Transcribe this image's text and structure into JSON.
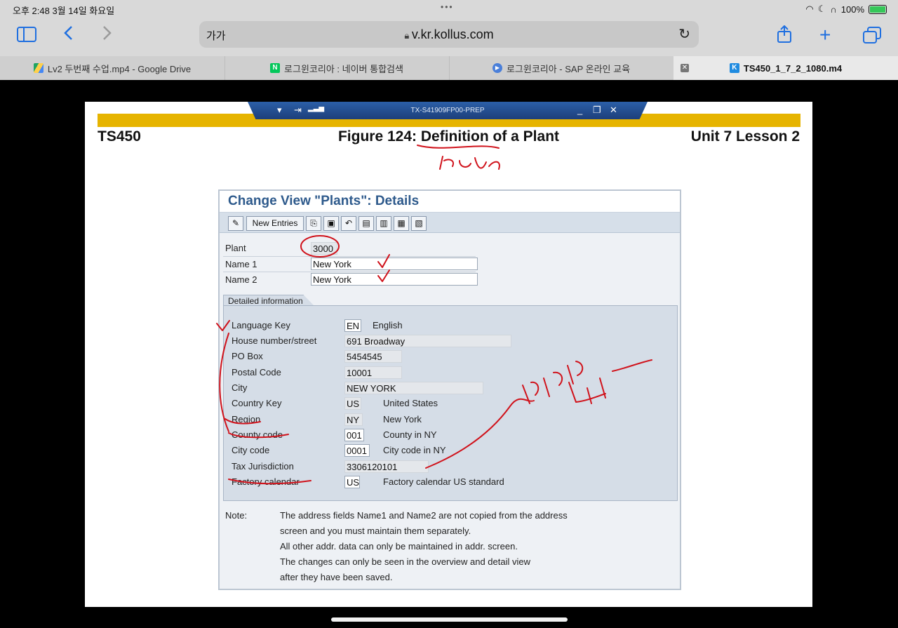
{
  "status_bar": {
    "time": "오후 2:48   3월 14일 화요일",
    "battery": "100%"
  },
  "browser": {
    "text_size_label": "가가",
    "url": "v.kr.kollus.com",
    "tabs": [
      {
        "title": "Lv2 두번째 수업.mp4 - Google Drive",
        "icon": "google-drive-icon"
      },
      {
        "title": "로그윈코리아 : 네이버 통합검색",
        "icon": "naver-icon"
      },
      {
        "title": "로그윈코리아 - SAP 온라인 교육",
        "icon": "play-icon"
      },
      {
        "title": "TS450_1_7_2_1080.m4",
        "icon": "kollus-icon"
      }
    ]
  },
  "slide": {
    "window_title": "TX-S41909FP00-PREP",
    "left_header": "TS450",
    "center_header": "Figure 124: Definition of a Plant",
    "right_header": "Unit 7 Lesson 2",
    "sap_screen": {
      "title": "Change View \"Plants\": Details",
      "new_entries_label": "New Entries",
      "plant_label": "Plant",
      "plant_value": "3000",
      "name1_label": "Name 1",
      "name1_value": "New York",
      "name2_label": "Name 2",
      "name2_value": "New York",
      "group_title": "Detailed information",
      "fields": [
        {
          "label": "Language Key",
          "value": "EN",
          "desc": "English"
        },
        {
          "label": "House number/street",
          "value": "691 Broadway",
          "desc": ""
        },
        {
          "label": "PO Box",
          "value": "5454545",
          "desc": ""
        },
        {
          "label": "Postal Code",
          "value": "10001",
          "desc": ""
        },
        {
          "label": "City",
          "value": "NEW YORK",
          "desc": ""
        },
        {
          "label": "Country Key",
          "value": "US",
          "desc": "United States"
        },
        {
          "label": "Region",
          "value": "NY",
          "desc": "New York"
        },
        {
          "label": "County code",
          "value": "001",
          "desc": "County in NY"
        },
        {
          "label": "City code",
          "value": "0001",
          "desc": "City code in NY"
        },
        {
          "label": "Tax Jurisdiction",
          "value": "3306120101",
          "desc": ""
        },
        {
          "label": "Factory calendar",
          "value": "US",
          "desc": "Factory calendar US standard"
        }
      ],
      "note_label": "Note:",
      "note_lines": [
        "The address fields Name1 and Name2 are not copied from the address",
        "screen and you must maintain them separately.",
        "All other addr. data can only be maintained in addr. screen.",
        "The changes can only be seen in the overview and detail view",
        "after they have been saved."
      ]
    }
  }
}
